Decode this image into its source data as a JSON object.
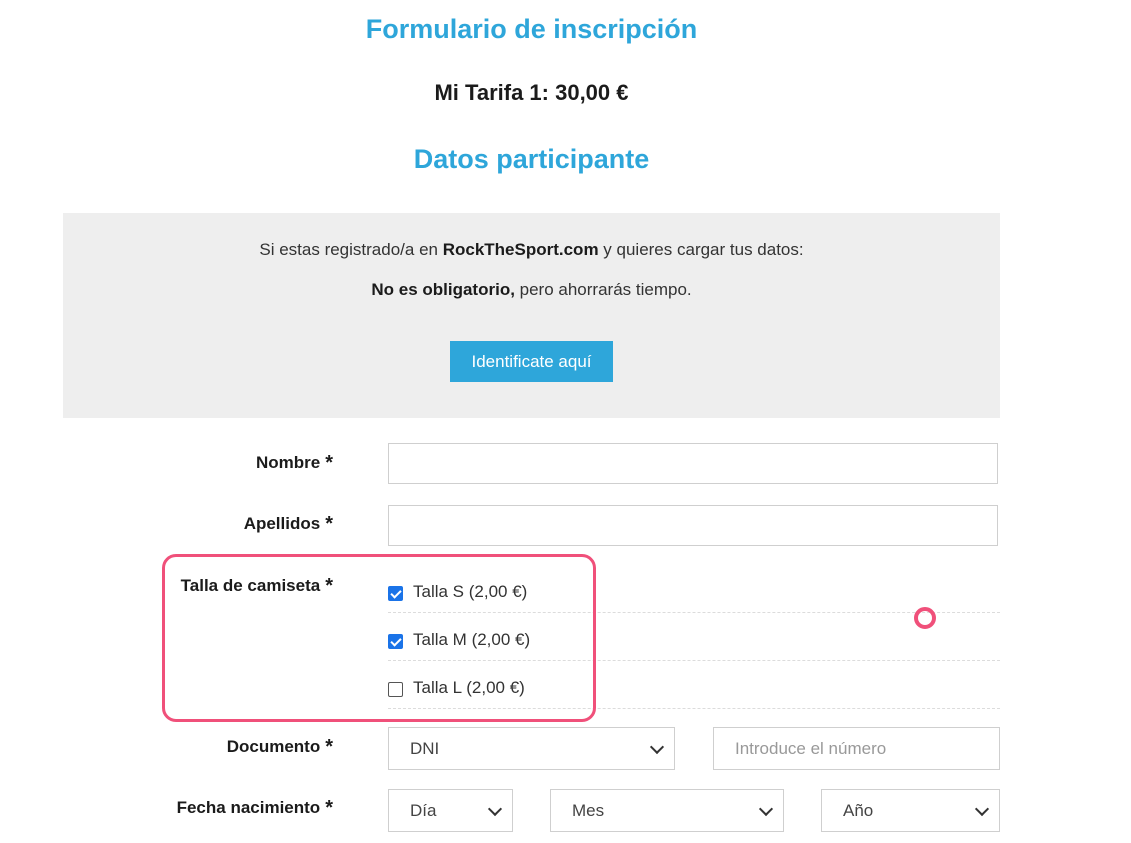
{
  "header": {
    "form_title": "Formulario de inscripción",
    "rate": "Mi Tarifa 1: 30,00 €",
    "participant_title": "Datos participante"
  },
  "login_box": {
    "line1_prefix": "Si estas registrado/a en ",
    "line1_brand": "RockTheSport.com",
    "line1_suffix": " y quieres cargar tus datos:",
    "line2_bold": "No es obligatorio,",
    "line2_rest": " pero ahorrarás tiempo.",
    "button_label": "Identificate aquí"
  },
  "fields": {
    "required_mark": "*",
    "nombre": {
      "label": "Nombre",
      "value": ""
    },
    "apellidos": {
      "label": "Apellidos",
      "value": ""
    },
    "talla": {
      "label": "Talla de camiseta",
      "options": [
        {
          "label": "Talla S (2,00 €)",
          "checked": true
        },
        {
          "label": "Talla M (2,00 €)",
          "checked": true
        },
        {
          "label": "Talla L (2,00 €)",
          "checked": false
        }
      ]
    },
    "documento": {
      "label": "Documento",
      "type_selected": "DNI",
      "number_placeholder": "Introduce el número"
    },
    "fecha": {
      "label": "Fecha nacimiento",
      "day_placeholder": "Día",
      "month_placeholder": "Mes",
      "year_placeholder": "Año"
    }
  },
  "colors": {
    "accent": "#2ea6da",
    "highlight": "#f0507a",
    "checkbox": "#1a73e8",
    "panel_bg": "#eeeeee"
  }
}
